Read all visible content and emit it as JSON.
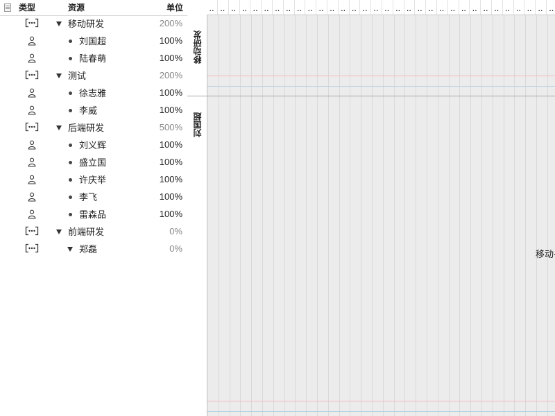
{
  "left_panel": {
    "headers": {
      "type": "类型",
      "resource": "资源",
      "unit": "单位"
    },
    "header_icon": "document-icon",
    "rows": [
      {
        "kind": "group",
        "nested": false,
        "name": "移动研发",
        "unit": "200%",
        "icon": "group-icon"
      },
      {
        "kind": "person",
        "nested": false,
        "name": "刘国超",
        "unit": "100%",
        "icon": "person-icon"
      },
      {
        "kind": "person",
        "nested": false,
        "name": "陆春萌",
        "unit": "100%",
        "icon": "person-icon"
      },
      {
        "kind": "group",
        "nested": false,
        "name": "测试",
        "unit": "200%",
        "icon": "group-icon"
      },
      {
        "kind": "person",
        "nested": false,
        "name": "徐志雅",
        "unit": "100%",
        "icon": "person-icon"
      },
      {
        "kind": "person",
        "nested": false,
        "name": "李威",
        "unit": "100%",
        "icon": "person-icon"
      },
      {
        "kind": "group",
        "nested": false,
        "name": "后端研发",
        "unit": "500%",
        "icon": "group-icon"
      },
      {
        "kind": "person",
        "nested": false,
        "name": "刘义辉",
        "unit": "100%",
        "icon": "person-icon"
      },
      {
        "kind": "person",
        "nested": false,
        "name": "盛立国",
        "unit": "100%",
        "icon": "person-icon"
      },
      {
        "kind": "person",
        "nested": false,
        "name": "许庆举",
        "unit": "100%",
        "icon": "person-icon"
      },
      {
        "kind": "person",
        "nested": false,
        "name": "李飞",
        "unit": "100%",
        "icon": "person-icon"
      },
      {
        "kind": "person",
        "nested": false,
        "name": "雷森品",
        "unit": "100%",
        "icon": "person-icon"
      },
      {
        "kind": "group",
        "nested": false,
        "name": "前端研发",
        "unit": "0%",
        "icon": "group-icon"
      },
      {
        "kind": "group",
        "nested": true,
        "name": "郑磊",
        "unit": "0%",
        "icon": "group-icon"
      }
    ]
  },
  "gantt": {
    "header_tick_text": "..",
    "lanes": [
      {
        "label": "移动研发"
      },
      {
        "label": "刘国超"
      }
    ],
    "bar_label": "移动-",
    "colors": {
      "background": "#ececec",
      "grid": "#d9d9d9",
      "red_line": "#f0b8bd",
      "blue_line": "#b9d2e2",
      "divider": "#a6a6a6"
    }
  }
}
